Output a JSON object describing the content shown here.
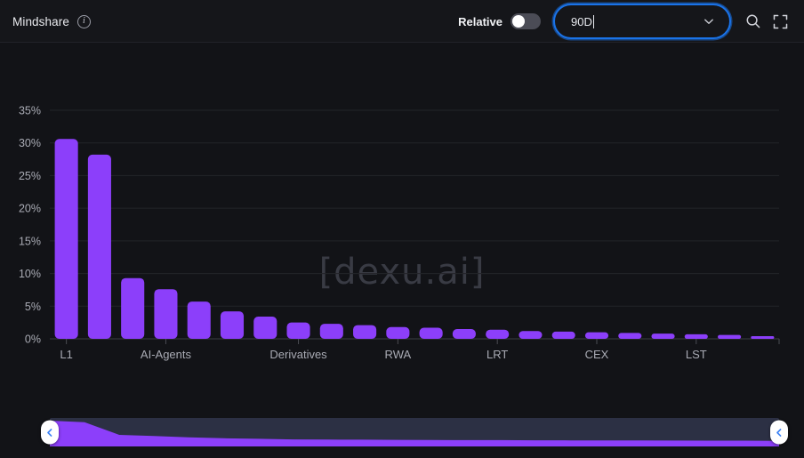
{
  "header": {
    "title": "Mindshare",
    "info_icon": "info-icon",
    "relative_label": "Relative",
    "relative_toggle_state": "off",
    "period_value": "90D",
    "period_chevron_icon": "chevron-down-icon",
    "search_icon": "search-icon",
    "fullscreen_icon": "fullscreen-icon"
  },
  "watermark": "[dexu.ai]",
  "colors": {
    "bar": "#8c3ffa",
    "accent_blue": "#1a73e8",
    "background": "#121317",
    "header_background": "#15161a",
    "grid": "#232428",
    "brush_track": "#2c3044",
    "brush_area": "#8c3ffa"
  },
  "brush": {
    "left_handle_icon": "chevron-left-icon",
    "right_handle_icon": "chevron-left-icon",
    "range_start_pct": 0,
    "range_end_pct": 100
  },
  "chart_data": {
    "type": "bar",
    "title": "Mindshare",
    "xlabel": "",
    "ylabel": "",
    "ylim": [
      0,
      35
    ],
    "ytick_labels": [
      "0%",
      "5%",
      "10%",
      "15%",
      "20%",
      "25%",
      "30%",
      "35%"
    ],
    "ytick_values": [
      0,
      5,
      10,
      15,
      20,
      25,
      30,
      35
    ],
    "grid": true,
    "legend": "none",
    "xtick_labels": [
      "L1",
      "AI-Agents",
      "Derivatives",
      "RWA",
      "LRT",
      "CEX",
      "LST"
    ],
    "xtick_indices": [
      0,
      3,
      7,
      10,
      13,
      16,
      19
    ],
    "categories": [
      "L1",
      "",
      "",
      "AI-Agents",
      "",
      "",
      "",
      "Derivatives",
      "",
      "",
      "RWA",
      "",
      "",
      "LRT",
      "",
      "",
      "CEX",
      "",
      "",
      "LST",
      "",
      ""
    ],
    "values": [
      30.6,
      28.2,
      9.3,
      7.6,
      5.7,
      4.2,
      3.4,
      2.5,
      2.3,
      2.1,
      1.8,
      1.7,
      1.5,
      1.4,
      1.2,
      1.1,
      1.0,
      0.9,
      0.8,
      0.7,
      0.6,
      0.35
    ]
  }
}
